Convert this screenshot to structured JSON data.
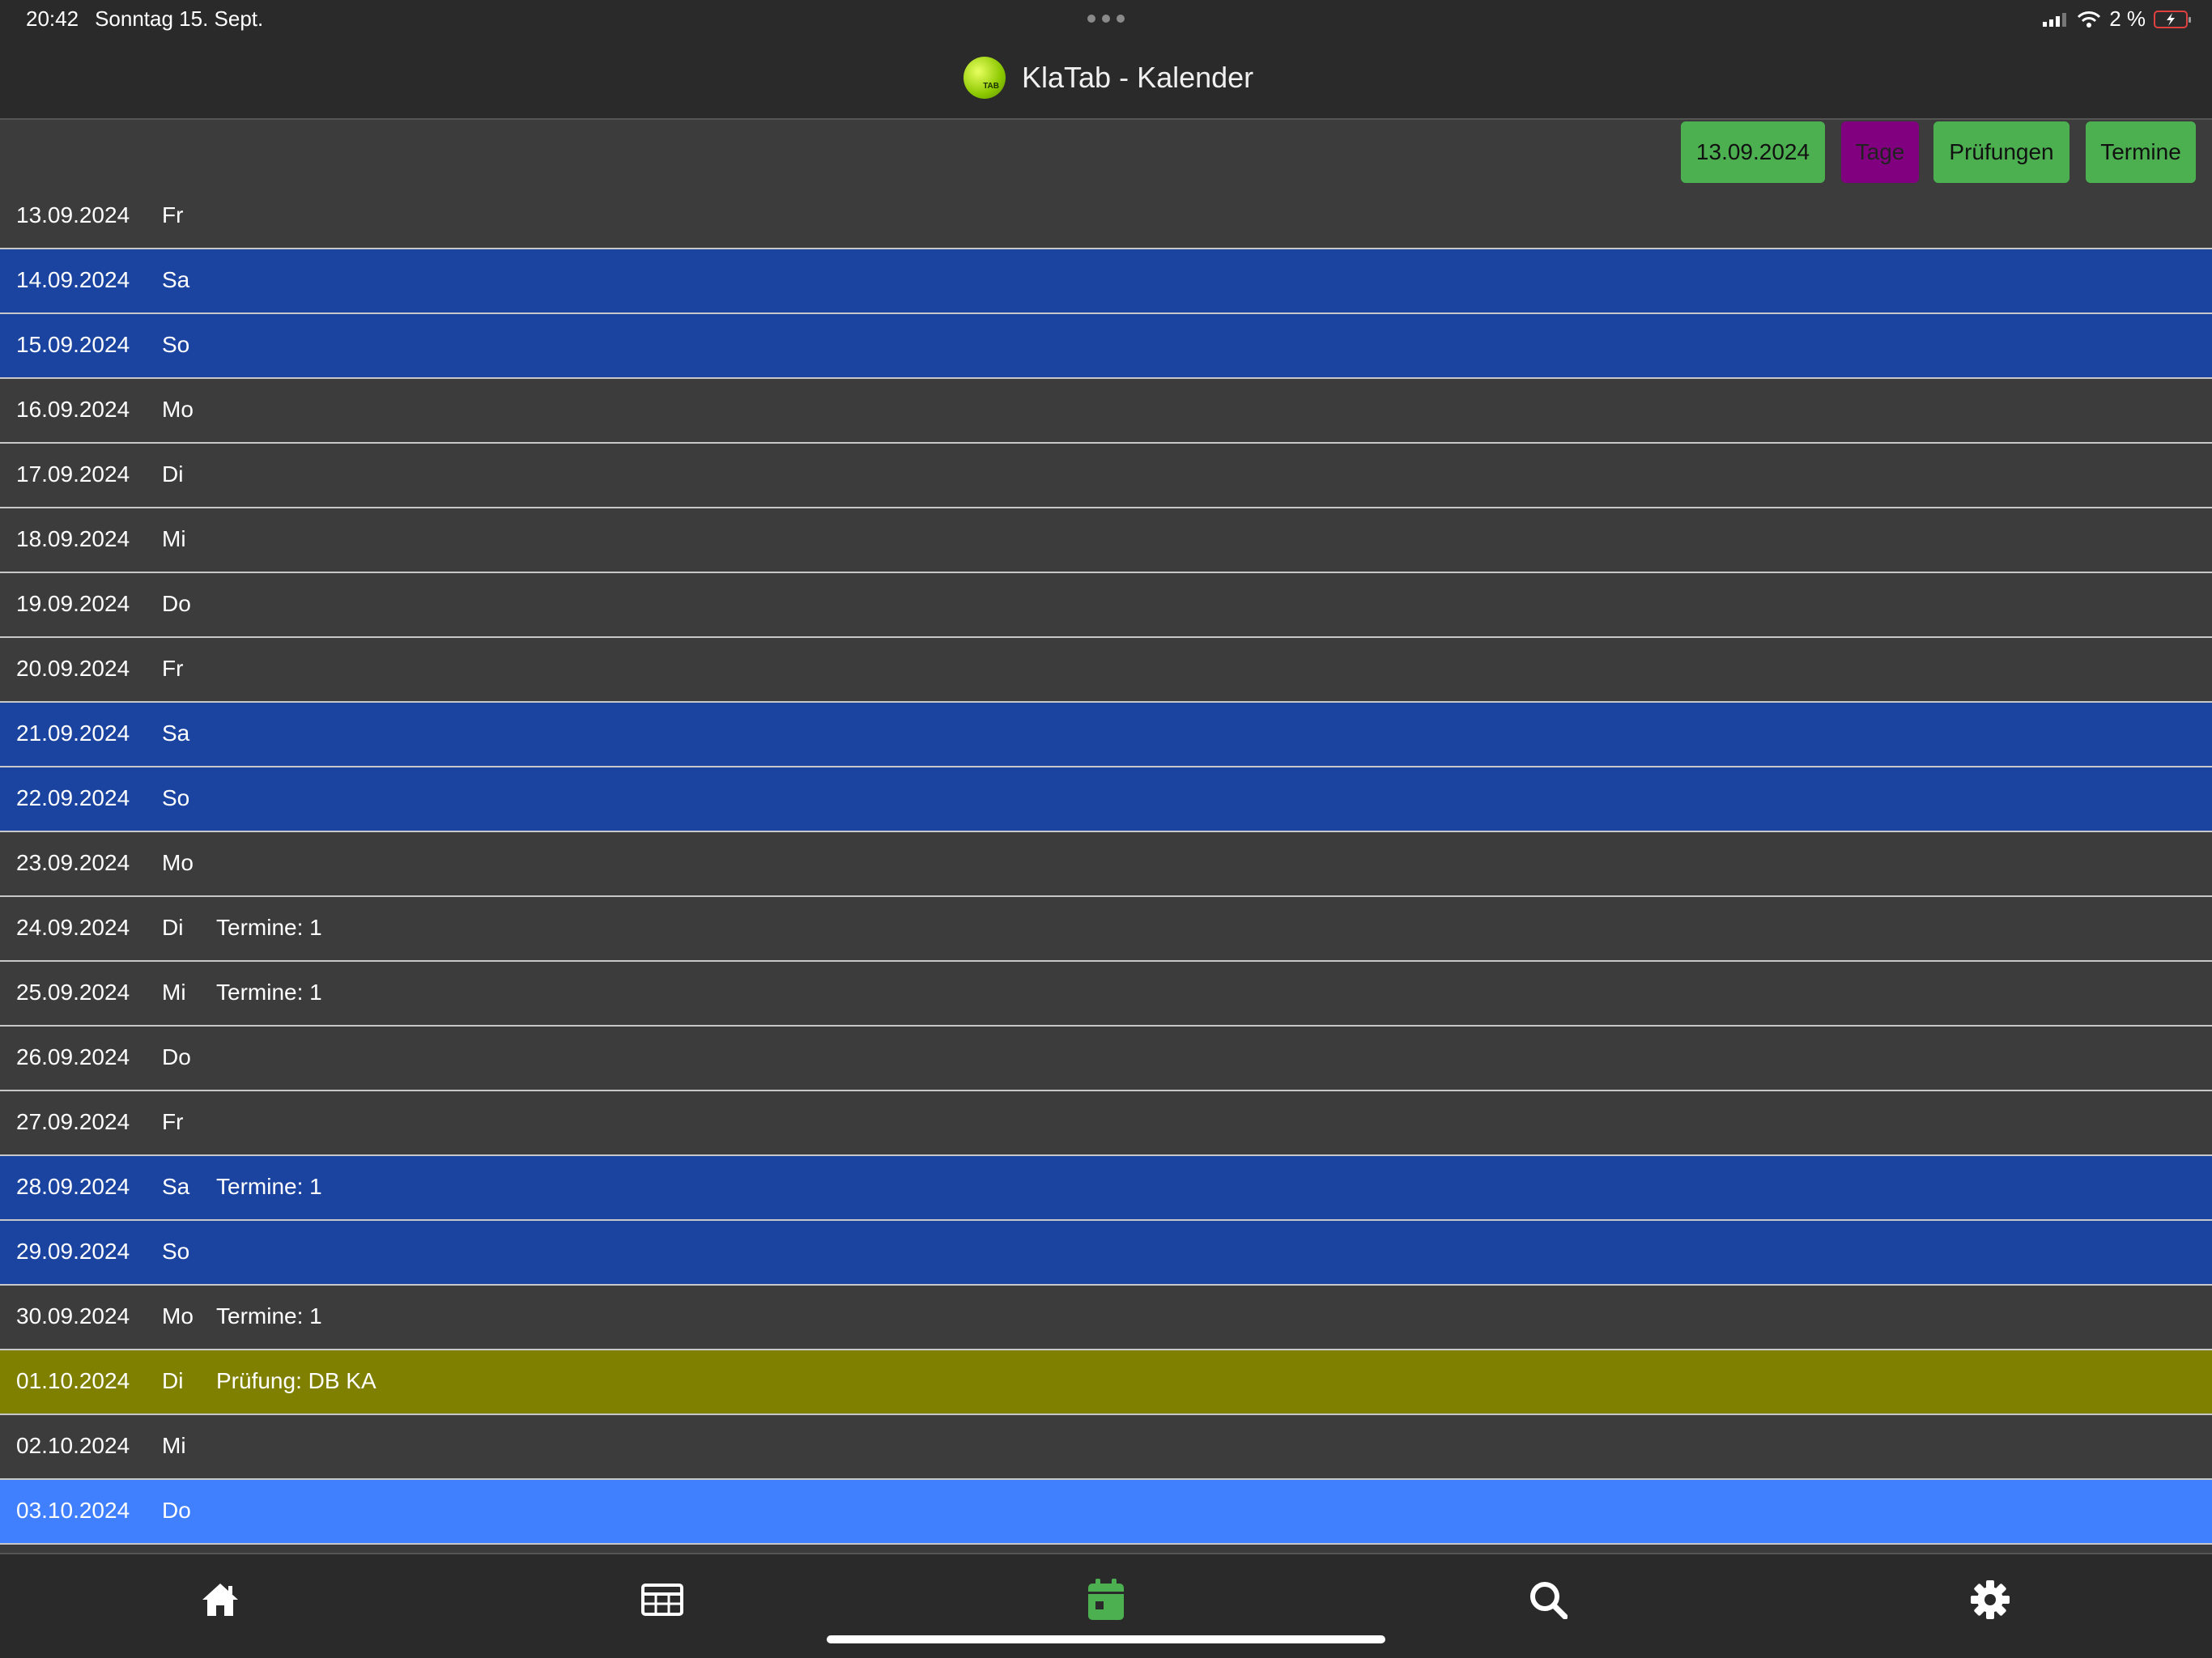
{
  "status_bar": {
    "time": "20:42",
    "date": "Sonntag 15. Sept.",
    "battery": "2 %"
  },
  "header": {
    "title": "KlaTab - Kalender",
    "logo_text": "TAB"
  },
  "toolbar": {
    "date_button": "13.09.2024",
    "tage_button": "Tage",
    "pruefungen_button": "Prüfungen",
    "termine_button": "Termine"
  },
  "rows": [
    {
      "date": "13.09.2024",
      "weekday": "Fr",
      "info": "",
      "type": "normal"
    },
    {
      "date": "14.09.2024",
      "weekday": "Sa",
      "info": "",
      "type": "weekend"
    },
    {
      "date": "15.09.2024",
      "weekday": "So",
      "info": "",
      "type": "weekend"
    },
    {
      "date": "16.09.2024",
      "weekday": "Mo",
      "info": "",
      "type": "normal"
    },
    {
      "date": "17.09.2024",
      "weekday": "Di",
      "info": "",
      "type": "normal"
    },
    {
      "date": "18.09.2024",
      "weekday": "Mi",
      "info": "",
      "type": "normal"
    },
    {
      "date": "19.09.2024",
      "weekday": "Do",
      "info": "",
      "type": "normal"
    },
    {
      "date": "20.09.2024",
      "weekday": "Fr",
      "info": "",
      "type": "normal"
    },
    {
      "date": "21.09.2024",
      "weekday": "Sa",
      "info": "",
      "type": "weekend"
    },
    {
      "date": "22.09.2024",
      "weekday": "So",
      "info": "",
      "type": "weekend"
    },
    {
      "date": "23.09.2024",
      "weekday": "Mo",
      "info": "",
      "type": "normal"
    },
    {
      "date": "24.09.2024",
      "weekday": "Di",
      "info": "Termine: 1",
      "type": "normal"
    },
    {
      "date": "25.09.2024",
      "weekday": "Mi",
      "info": "Termine: 1",
      "type": "normal"
    },
    {
      "date": "26.09.2024",
      "weekday": "Do",
      "info": "",
      "type": "normal"
    },
    {
      "date": "27.09.2024",
      "weekday": "Fr",
      "info": "",
      "type": "normal"
    },
    {
      "date": "28.09.2024",
      "weekday": "Sa",
      "info": "Termine: 1",
      "type": "weekend"
    },
    {
      "date": "29.09.2024",
      "weekday": "So",
      "info": "",
      "type": "weekend"
    },
    {
      "date": "30.09.2024",
      "weekday": "Mo",
      "info": "Termine: 1",
      "type": "normal"
    },
    {
      "date": "01.10.2024",
      "weekday": "Di",
      "info": "Prüfung: DB KA",
      "type": "exam"
    },
    {
      "date": "02.10.2024",
      "weekday": "Mi",
      "info": "",
      "type": "normal"
    },
    {
      "date": "03.10.2024",
      "weekday": "Do",
      "info": "",
      "type": "holiday"
    }
  ],
  "colors": {
    "normal": "#3c3c3c",
    "weekend": "#1a44a0",
    "exam": "#808000",
    "holiday": "#4080ff",
    "accent_green": "#4caf50",
    "tage_purple": "#800080"
  },
  "bottom_nav": {
    "items": [
      "home-icon",
      "table-icon",
      "calendar-icon",
      "search-icon",
      "gear-icon"
    ],
    "active": "calendar-icon"
  }
}
